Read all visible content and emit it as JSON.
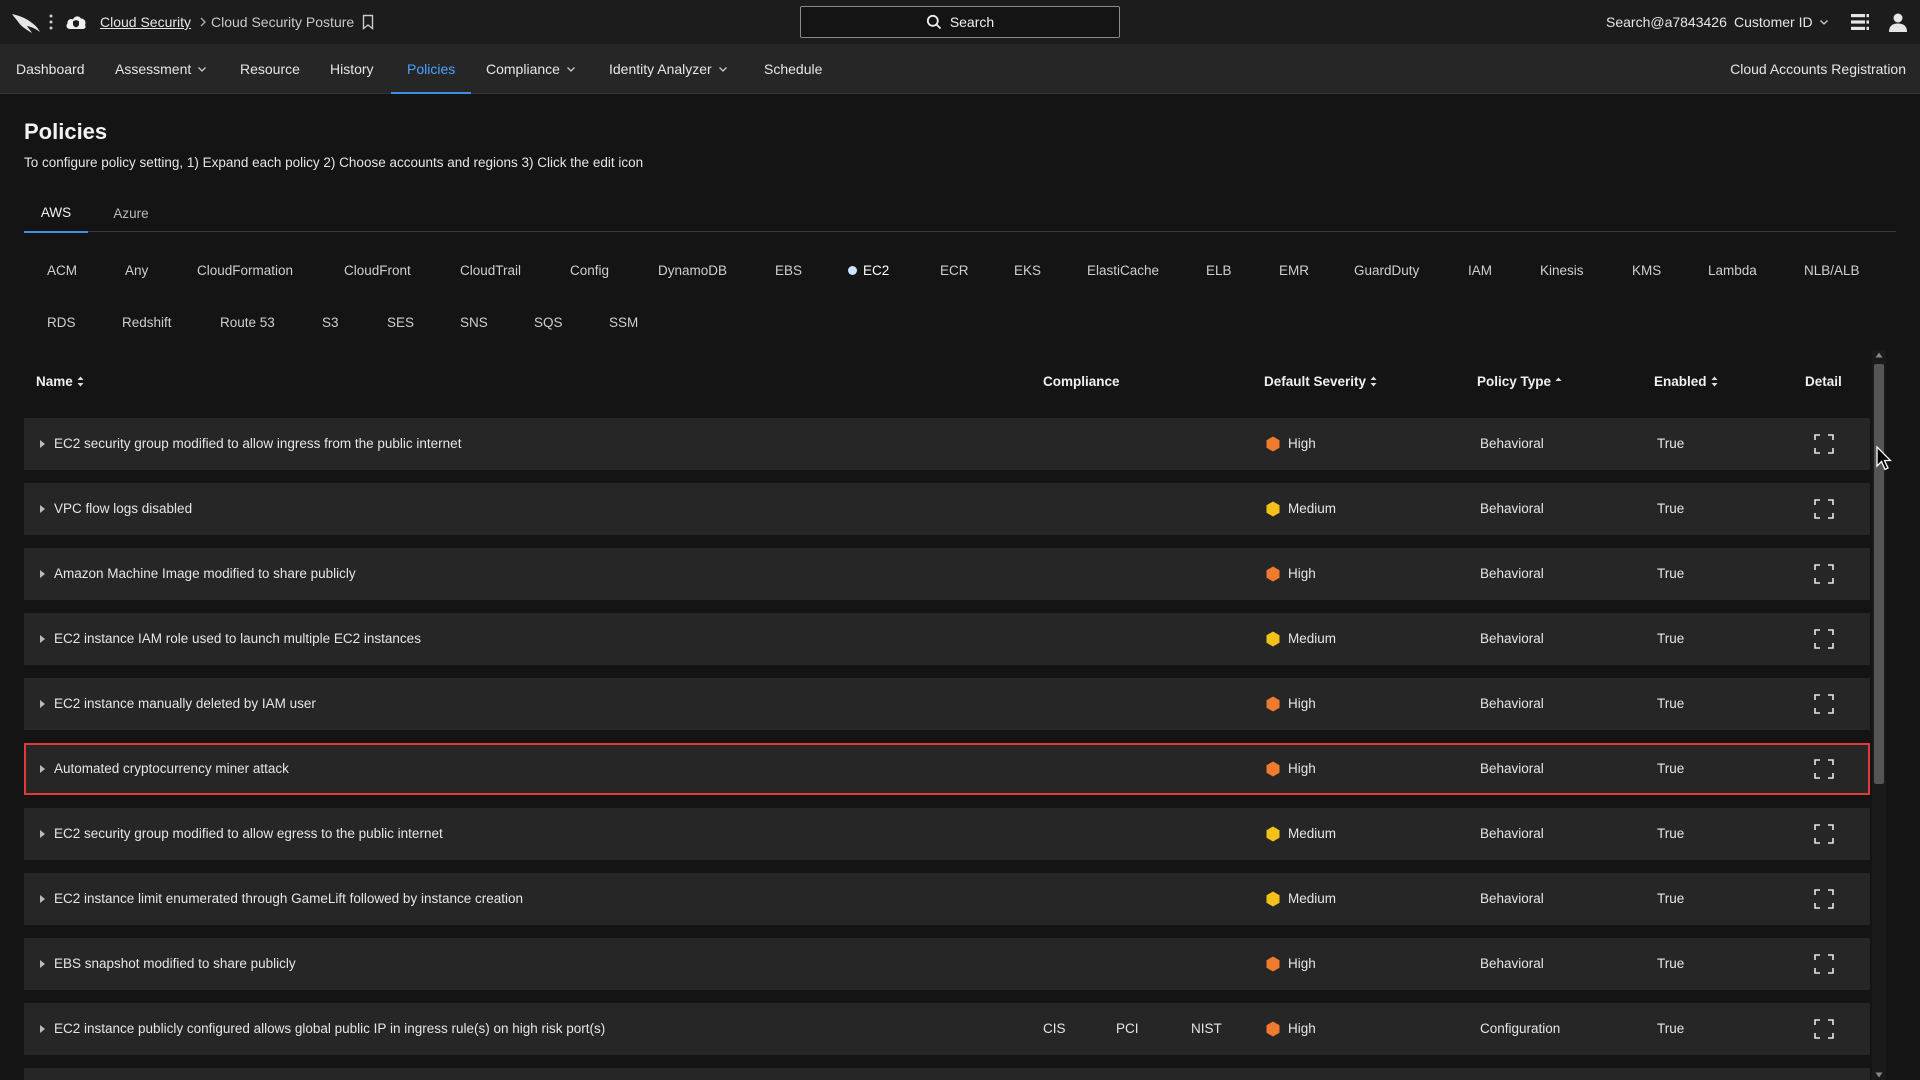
{
  "topbar": {
    "breadcrumb_root": "Cloud Security",
    "breadcrumb_current": "Cloud Security Posture",
    "search_label": "Search",
    "user_email": "Search@a7843426",
    "customer_label": "Customer ID"
  },
  "nav": {
    "items": [
      {
        "label": "Dashboard",
        "dropdown": false
      },
      {
        "label": "Assessment",
        "dropdown": true
      },
      {
        "label": "Resource",
        "dropdown": false
      },
      {
        "label": "History",
        "dropdown": false
      },
      {
        "label": "Policies",
        "dropdown": false,
        "active": true
      },
      {
        "label": "Compliance",
        "dropdown": true
      },
      {
        "label": "Identity Analyzer",
        "dropdown": true
      },
      {
        "label": "Schedule",
        "dropdown": false
      }
    ],
    "right_link": "Cloud Accounts Registration"
  },
  "page": {
    "title": "Policies",
    "description": "To configure policy setting, 1) Expand each policy 2) Choose accounts and regions 3) Click the edit icon"
  },
  "cloud_tabs": [
    {
      "label": "AWS",
      "active": true
    },
    {
      "label": "Azure",
      "active": false
    }
  ],
  "services_row1": [
    "ACM",
    "Any",
    "CloudFormation",
    "CloudFront",
    "CloudTrail",
    "Config",
    "DynamoDB",
    "EBS",
    "EC2",
    "ECR",
    "EKS",
    "ElastiCache",
    "ELB",
    "EMR",
    "GuardDuty",
    "IAM",
    "Kinesis",
    "KMS",
    "Lambda",
    "NLB/ALB"
  ],
  "services_row2": [
    "RDS",
    "Redshift",
    "Route 53",
    "S3",
    "SES",
    "SNS",
    "SQS",
    "SSM"
  ],
  "active_service": "EC2",
  "table": {
    "headers": {
      "name": "Name",
      "compliance": "Compliance",
      "severity": "Default Severity",
      "policy_type": "Policy Type",
      "enabled": "Enabled",
      "detail": "Detail"
    },
    "rows": [
      {
        "name": "EC2 security group modified to allow ingress from the public internet",
        "compliance": [],
        "severity": "High",
        "policy_type": "Behavioral",
        "enabled": "True"
      },
      {
        "name": "VPC flow logs disabled",
        "compliance": [],
        "severity": "Medium",
        "policy_type": "Behavioral",
        "enabled": "True"
      },
      {
        "name": "Amazon Machine Image modified to share publicly",
        "compliance": [],
        "severity": "High",
        "policy_type": "Behavioral",
        "enabled": "True"
      },
      {
        "name": "EC2 instance IAM role used to launch multiple EC2 instances",
        "compliance": [],
        "severity": "Medium",
        "policy_type": "Behavioral",
        "enabled": "True"
      },
      {
        "name": "EC2 instance manually deleted by IAM user",
        "compliance": [],
        "severity": "High",
        "policy_type": "Behavioral",
        "enabled": "True"
      },
      {
        "name": "Automated cryptocurrency miner attack",
        "compliance": [],
        "severity": "High",
        "policy_type": "Behavioral",
        "enabled": "True",
        "highlighted": true
      },
      {
        "name": "EC2 security group modified to allow egress to the public internet",
        "compliance": [],
        "severity": "Medium",
        "policy_type": "Behavioral",
        "enabled": "True"
      },
      {
        "name": "EC2 instance limit enumerated through GameLift followed by instance creation",
        "compliance": [],
        "severity": "Medium",
        "policy_type": "Behavioral",
        "enabled": "True"
      },
      {
        "name": "EBS snapshot modified to share publicly",
        "compliance": [],
        "severity": "High",
        "policy_type": "Behavioral",
        "enabled": "True"
      },
      {
        "name": "EC2 instance publicly configured allows global public IP in ingress rule(s) on high risk port(s)",
        "compliance": [
          "CIS",
          "PCI",
          "NIST"
        ],
        "severity": "High",
        "policy_type": "Configuration",
        "enabled": "True"
      }
    ]
  },
  "colors": {
    "severity_high": "#f07a2e",
    "severity_medium": "#f2c21b",
    "accent": "#3a8fe8",
    "highlight_border": "#e23a3a"
  }
}
